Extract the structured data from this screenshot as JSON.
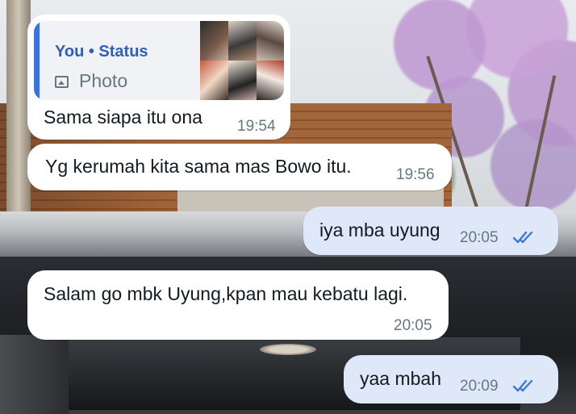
{
  "chat": {
    "quoted_status": {
      "author": "You • Status",
      "media_type": "Photo",
      "icon": "photo-icon"
    },
    "messages": [
      {
        "direction": "incoming",
        "text": "Sama siapa itu ona",
        "time": "19:54",
        "has_quote": true
      },
      {
        "direction": "incoming",
        "text": "Yg kerumah kita sama mas Bowo itu.",
        "time": "19:56"
      },
      {
        "direction": "outgoing",
        "text": "iya mba uyung",
        "time": "20:05",
        "status": "read"
      },
      {
        "direction": "incoming",
        "text": "Salam go mbk Uyung,kpan mau kebatu lagi.",
        "time": "20:05"
      },
      {
        "direction": "outgoing",
        "text": "yaa mbah",
        "time": "20:09",
        "status": "read"
      }
    ]
  },
  "colors": {
    "incoming_bubble": "#ffffff",
    "outgoing_bubble": "#dfe8f8",
    "read_ticks": "#3b78d8",
    "quote_accent": "#3a73e0",
    "timestamp": "#667781"
  }
}
